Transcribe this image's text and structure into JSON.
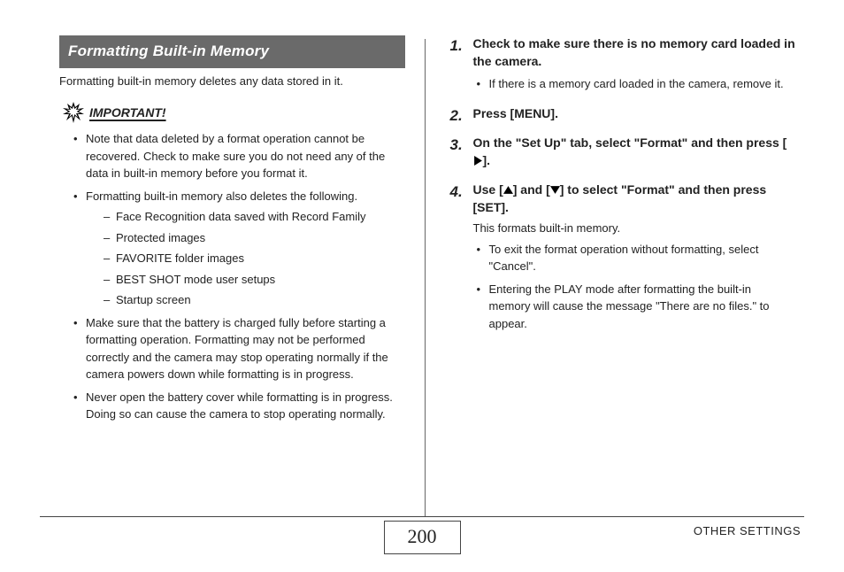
{
  "sectionTitle": "Formatting Built-in Memory",
  "intro": "Formatting built-in memory deletes any data stored in it.",
  "importantLabel": "IMPORTANT!",
  "important": {
    "b1": "Note that data deleted by a format operation cannot be recovered. Check to make sure you do not need any of the data in built-in memory before you format it.",
    "b2": "Formatting built-in memory also deletes the following.",
    "b2subs": {
      "s1": "Face Recognition data saved with Record Family",
      "s2": "Protected images",
      "s3": "FAVORITE folder images",
      "s4": "BEST SHOT mode user setups",
      "s5": "Startup screen"
    },
    "b3": "Make sure that the battery is charged fully before starting a formatting operation. Formatting may not be performed correctly and the camera may stop operating normally if the camera powers down while formatting is in progress.",
    "b4": "Never open the battery cover while formatting is in progress. Doing so can cause the camera to stop operating normally."
  },
  "steps": {
    "n1": "1.",
    "n2": "2.",
    "n3": "3.",
    "n4": "4.",
    "s1head": "Check to make sure there is no memory card loaded in the camera.",
    "s1b1": "If there is a memory card loaded in the camera, remove it.",
    "s2head": "Press [MENU].",
    "s3pre": "On the \"Set Up\" tab, select \"Format\" and then press [",
    "s3post": "].",
    "s4pre": "Use [",
    "s4mid": "] and [",
    "s4post": "] to select \"Format\" and then press [SET].",
    "s4body": "This formats built-in memory.",
    "s4b1": "To exit the format operation without formatting, select \"Cancel\".",
    "s4b2": "Entering the PLAY mode after formatting the built-in memory will cause the message \"There are no files.\" to appear."
  },
  "footer": {
    "pageNumber": "200",
    "sectionLabel": "OTHER SETTINGS"
  }
}
